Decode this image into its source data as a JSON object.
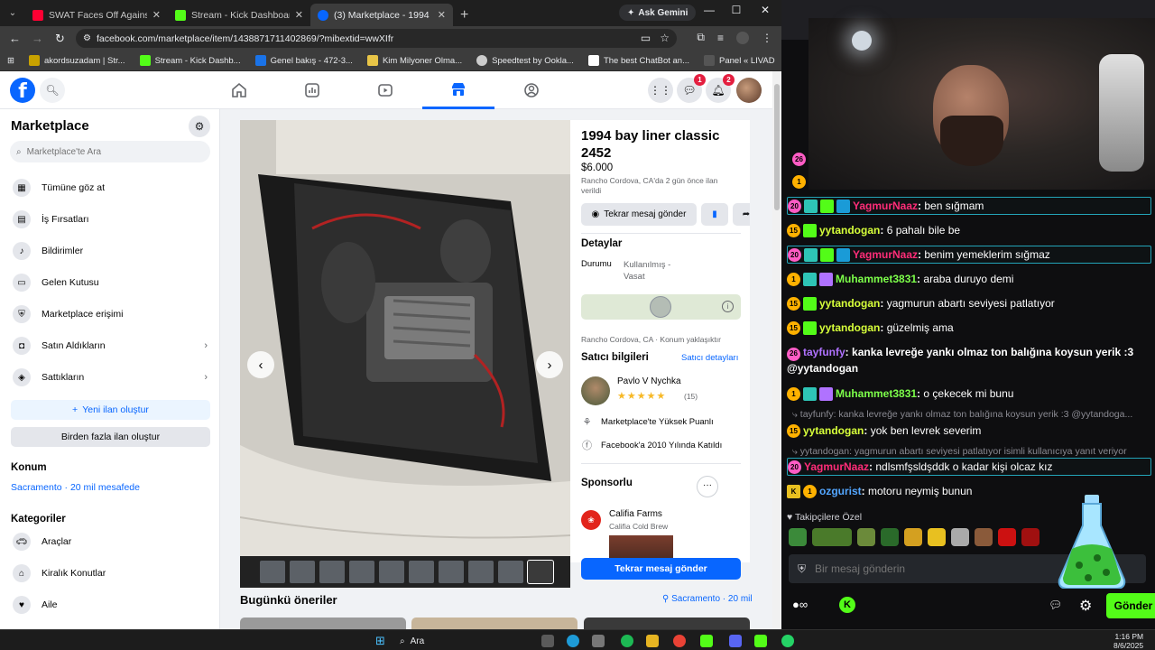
{
  "browser": {
    "tabs": [
      {
        "label": "SWAT Faces Off Against Killer 4",
        "favicon_color": "#ff0033"
      },
      {
        "label": "Stream - Kick Dashboard",
        "favicon_color": "#53fc18"
      },
      {
        "label": "(3) Marketplace - 1994 bay liner",
        "favicon_color": "#0866ff"
      }
    ],
    "ask_gemini": "Ask Gemini",
    "url": "facebook.com/marketplace/item/1438871711402869/?mibextid=wwXIfr",
    "bookmarks": [
      {
        "label": "akordsuzadam | Str...",
        "color": "#c8a200"
      },
      {
        "label": "Stream - Kick Dashb...",
        "color": "#53fc18"
      },
      {
        "label": "Genel bakış - 472-3...",
        "color": "#1a73e8"
      },
      {
        "label": "Kim Milyoner Olma...",
        "color": "#e8c547"
      },
      {
        "label": "Speedtest by Ookla...",
        "color": "#cccccc"
      },
      {
        "label": "The best ChatBot an...",
        "color": "#ffffff"
      },
      {
        "label": "Panel « LIVAD",
        "color": "#555555"
      }
    ]
  },
  "facebook": {
    "logo": "f",
    "messenger_badge": "1",
    "notifications_badge": "2",
    "sidebar": {
      "title": "Marketplace",
      "search_placeholder": "Marketplace'te Ara",
      "items": [
        {
          "label": "Tümüne göz at",
          "icon": "store-icon"
        },
        {
          "label": "İş Fırsatları",
          "icon": "briefcase-icon"
        },
        {
          "label": "Bildirimler",
          "icon": "bell-icon"
        },
        {
          "label": "Gelen Kutusu",
          "icon": "inbox-icon"
        },
        {
          "label": "Marketplace erişimi",
          "icon": "shield-icon"
        },
        {
          "label": "Satın Aldıkların",
          "icon": "bag-icon"
        },
        {
          "label": "Sattıkların",
          "icon": "tag-icon"
        }
      ],
      "new_listing": "Yeni ilan oluştur",
      "multi_listing": "Birden fazla ilan oluştur",
      "location_heading": "Konum",
      "location_value": "Sacramento · 20 mil mesafede",
      "categories_heading": "Kategoriler",
      "categories": [
        {
          "label": "Araçlar",
          "icon": "car-icon"
        },
        {
          "label": "Kiralık Konutlar",
          "icon": "house-icon"
        },
        {
          "label": "Aile",
          "icon": "heart-icon"
        }
      ]
    },
    "listing": {
      "title": "1994 bay liner classic 2452",
      "price": "$6.000",
      "posted": "Rancho Cordova, CA'da 2 gün önce ilan verildi",
      "message_button": "Tekrar mesaj gönder",
      "details_heading": "Detaylar",
      "condition_label": "Durumu",
      "condition_value": "Kullanılmış - Vasat",
      "map_location": "Rancho Cordova, CA · Konum yaklaşıktır",
      "seller_heading": "Satıcı bilgileri",
      "seller_details_link": "Satıcı detayları",
      "seller_name": "Pavlo V Nychka",
      "seller_stars": "★★★★★",
      "seller_rating_count": "(15)",
      "seller_badge": "Marketplace'te Yüksek Puanlı",
      "seller_joined": "Facebook'a 2010 Yılında Katıldı",
      "sponsored_heading": "Sponsorlu",
      "ad_name": "Califia Farms",
      "ad_sub": "Califia Cold Brew",
      "cta": "Tekrar mesaj gönder",
      "photo_count": 10,
      "selected_photo": 10
    },
    "today_heading": "Bugünkü öneriler",
    "today_location": "Sacramento · 20 mil"
  },
  "kick": {
    "messages": [
      {
        "badges": [
          "20"
        ],
        "extra": [
          "#2ec4b6",
          "#53fc18",
          "#1a9bd7"
        ],
        "user": "YagmurNaaz",
        "color": "#ff2d78",
        "text": "ben sığmam"
      },
      {
        "badges": [
          "15"
        ],
        "extra": [
          "#53fc18"
        ],
        "user": "yytandogan",
        "color": "#d7ff3a",
        "text": "6 pahalı bile be"
      },
      {
        "badges": [
          "20"
        ],
        "extra": [
          "#2ec4b6",
          "#53fc18",
          "#1a9bd7"
        ],
        "user": "YagmurNaaz",
        "color": "#ff2d78",
        "text": "benim yemeklerim sığmaz"
      },
      {
        "badges": [
          "1"
        ],
        "extra": [
          "#2ec4b6",
          "#b072ff"
        ],
        "user": "Muhammet3831",
        "color": "#7dff4a",
        "text": "araba duruyo demi"
      },
      {
        "badges": [
          "15"
        ],
        "extra": [
          "#53fc18"
        ],
        "user": "yytandogan",
        "color": "#d7ff3a",
        "text": "yagmurun abartı seviyesi patlatıyor"
      },
      {
        "badges": [
          "15"
        ],
        "extra": [
          "#53fc18"
        ],
        "user": "yytandogan",
        "color": "#d7ff3a",
        "text": "güzelmiş ama"
      }
    ],
    "wrap_message": {
      "badge": "26",
      "user": "tayfunfy",
      "color": "#b072ff",
      "text": "kanka levreğe yankı olmaz ton balığına koysun yerik :3 @yytandogan"
    },
    "msg_after_wrap": {
      "badges": [
        "1"
      ],
      "extra": [
        "#2ec4b6",
        "#b072ff"
      ],
      "user": "Muhammet3831",
      "color": "#7dff4a",
      "text": "o çekecek mi bunu"
    },
    "reply1": "⤷ tayfunfy: kanka levreğe yankı olmaz ton balığına koysun yerik :3 @yytandoga...",
    "msg_reply1": {
      "badge": "15",
      "user": "yytandogan",
      "color": "#d7ff3a",
      "text": "yok ben levrek severim"
    },
    "reply2": "⤷ yytandogan: yagmurun abartı seviyesi patlatıyor isimli kullanıcıya yanıt veriyor",
    "msg_reply2": {
      "badge": "20",
      "user": "YagmurNaaz",
      "color": "#ff2d78",
      "text": "ndlsmfşsldşddk o kadar kişi olcaz kız"
    },
    "msg_last": {
      "badge": "1",
      "user": "ozgurist",
      "color": "#53a6ff",
      "text": "motoru neymiş bunun"
    },
    "top_badges": [
      "26",
      "1"
    ],
    "followers_label": "Takipçilere Özel",
    "input_placeholder": "Bir mesaj gönderin",
    "send": "Gönder"
  },
  "taskbar": {
    "search": "Ara",
    "time": "1:16 PM",
    "date": "8/6/2025"
  }
}
